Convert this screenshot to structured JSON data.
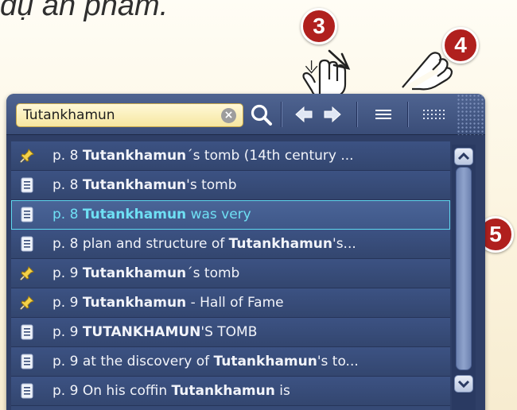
{
  "caption": "dụ ấn phẩm.",
  "callouts": [
    "3",
    "4",
    "5"
  ],
  "search": {
    "value": "Tutankhamun",
    "clear_symbol": "×"
  },
  "toolbar": {
    "search_icon": "magnifier-icon",
    "prev_icon": "arrow-left-icon",
    "next_icon": "arrow-right-icon",
    "list_view_icon": "list-lines-icon",
    "grid_view_icon": "dot-grid-icon"
  },
  "results": [
    {
      "icon": "pin",
      "page": "p. 8",
      "pre": "",
      "bold": "Tutankhamun",
      "post": "´s tomb (14th century ...",
      "selected": false
    },
    {
      "icon": "doc",
      "page": "p. 8",
      "pre": "",
      "bold": "Tutankhamun",
      "post": "'s tomb",
      "selected": false
    },
    {
      "icon": "doc",
      "page": "p. 8",
      "pre": "",
      "bold": "Tutankhamun",
      "post": " was very",
      "selected": true
    },
    {
      "icon": "doc",
      "page": "p. 8",
      "pre": "plan and structure of ",
      "bold": "Tutankhamun",
      "post": "'s...",
      "selected": false
    },
    {
      "icon": "pin",
      "page": "p. 9",
      "pre": "",
      "bold": "Tutankhamun",
      "post": "´s tomb",
      "selected": false
    },
    {
      "icon": "pin",
      "page": "p. 9",
      "pre": "",
      "bold": "Tutankhamun",
      "post": " - Hall of Fame",
      "selected": false
    },
    {
      "icon": "doc",
      "page": "p. 9",
      "pre": "",
      "bold": "TUTANKHAMUN",
      "post": "'S TOMB",
      "selected": false
    },
    {
      "icon": "doc",
      "page": "p. 9",
      "pre": "at the discovery of ",
      "bold": "Tutankhamun",
      "post": "'s to...",
      "selected": false
    },
    {
      "icon": "doc",
      "page": "p. 9",
      "pre": "On his coffin ",
      "bold": "Tutankhamun",
      "post": " is",
      "selected": false
    }
  ],
  "colors": {
    "panel": "#2f3f67",
    "highlight": "#6fe0f4",
    "badge": "#b0201e",
    "search_bg": "#f6e6a0"
  }
}
